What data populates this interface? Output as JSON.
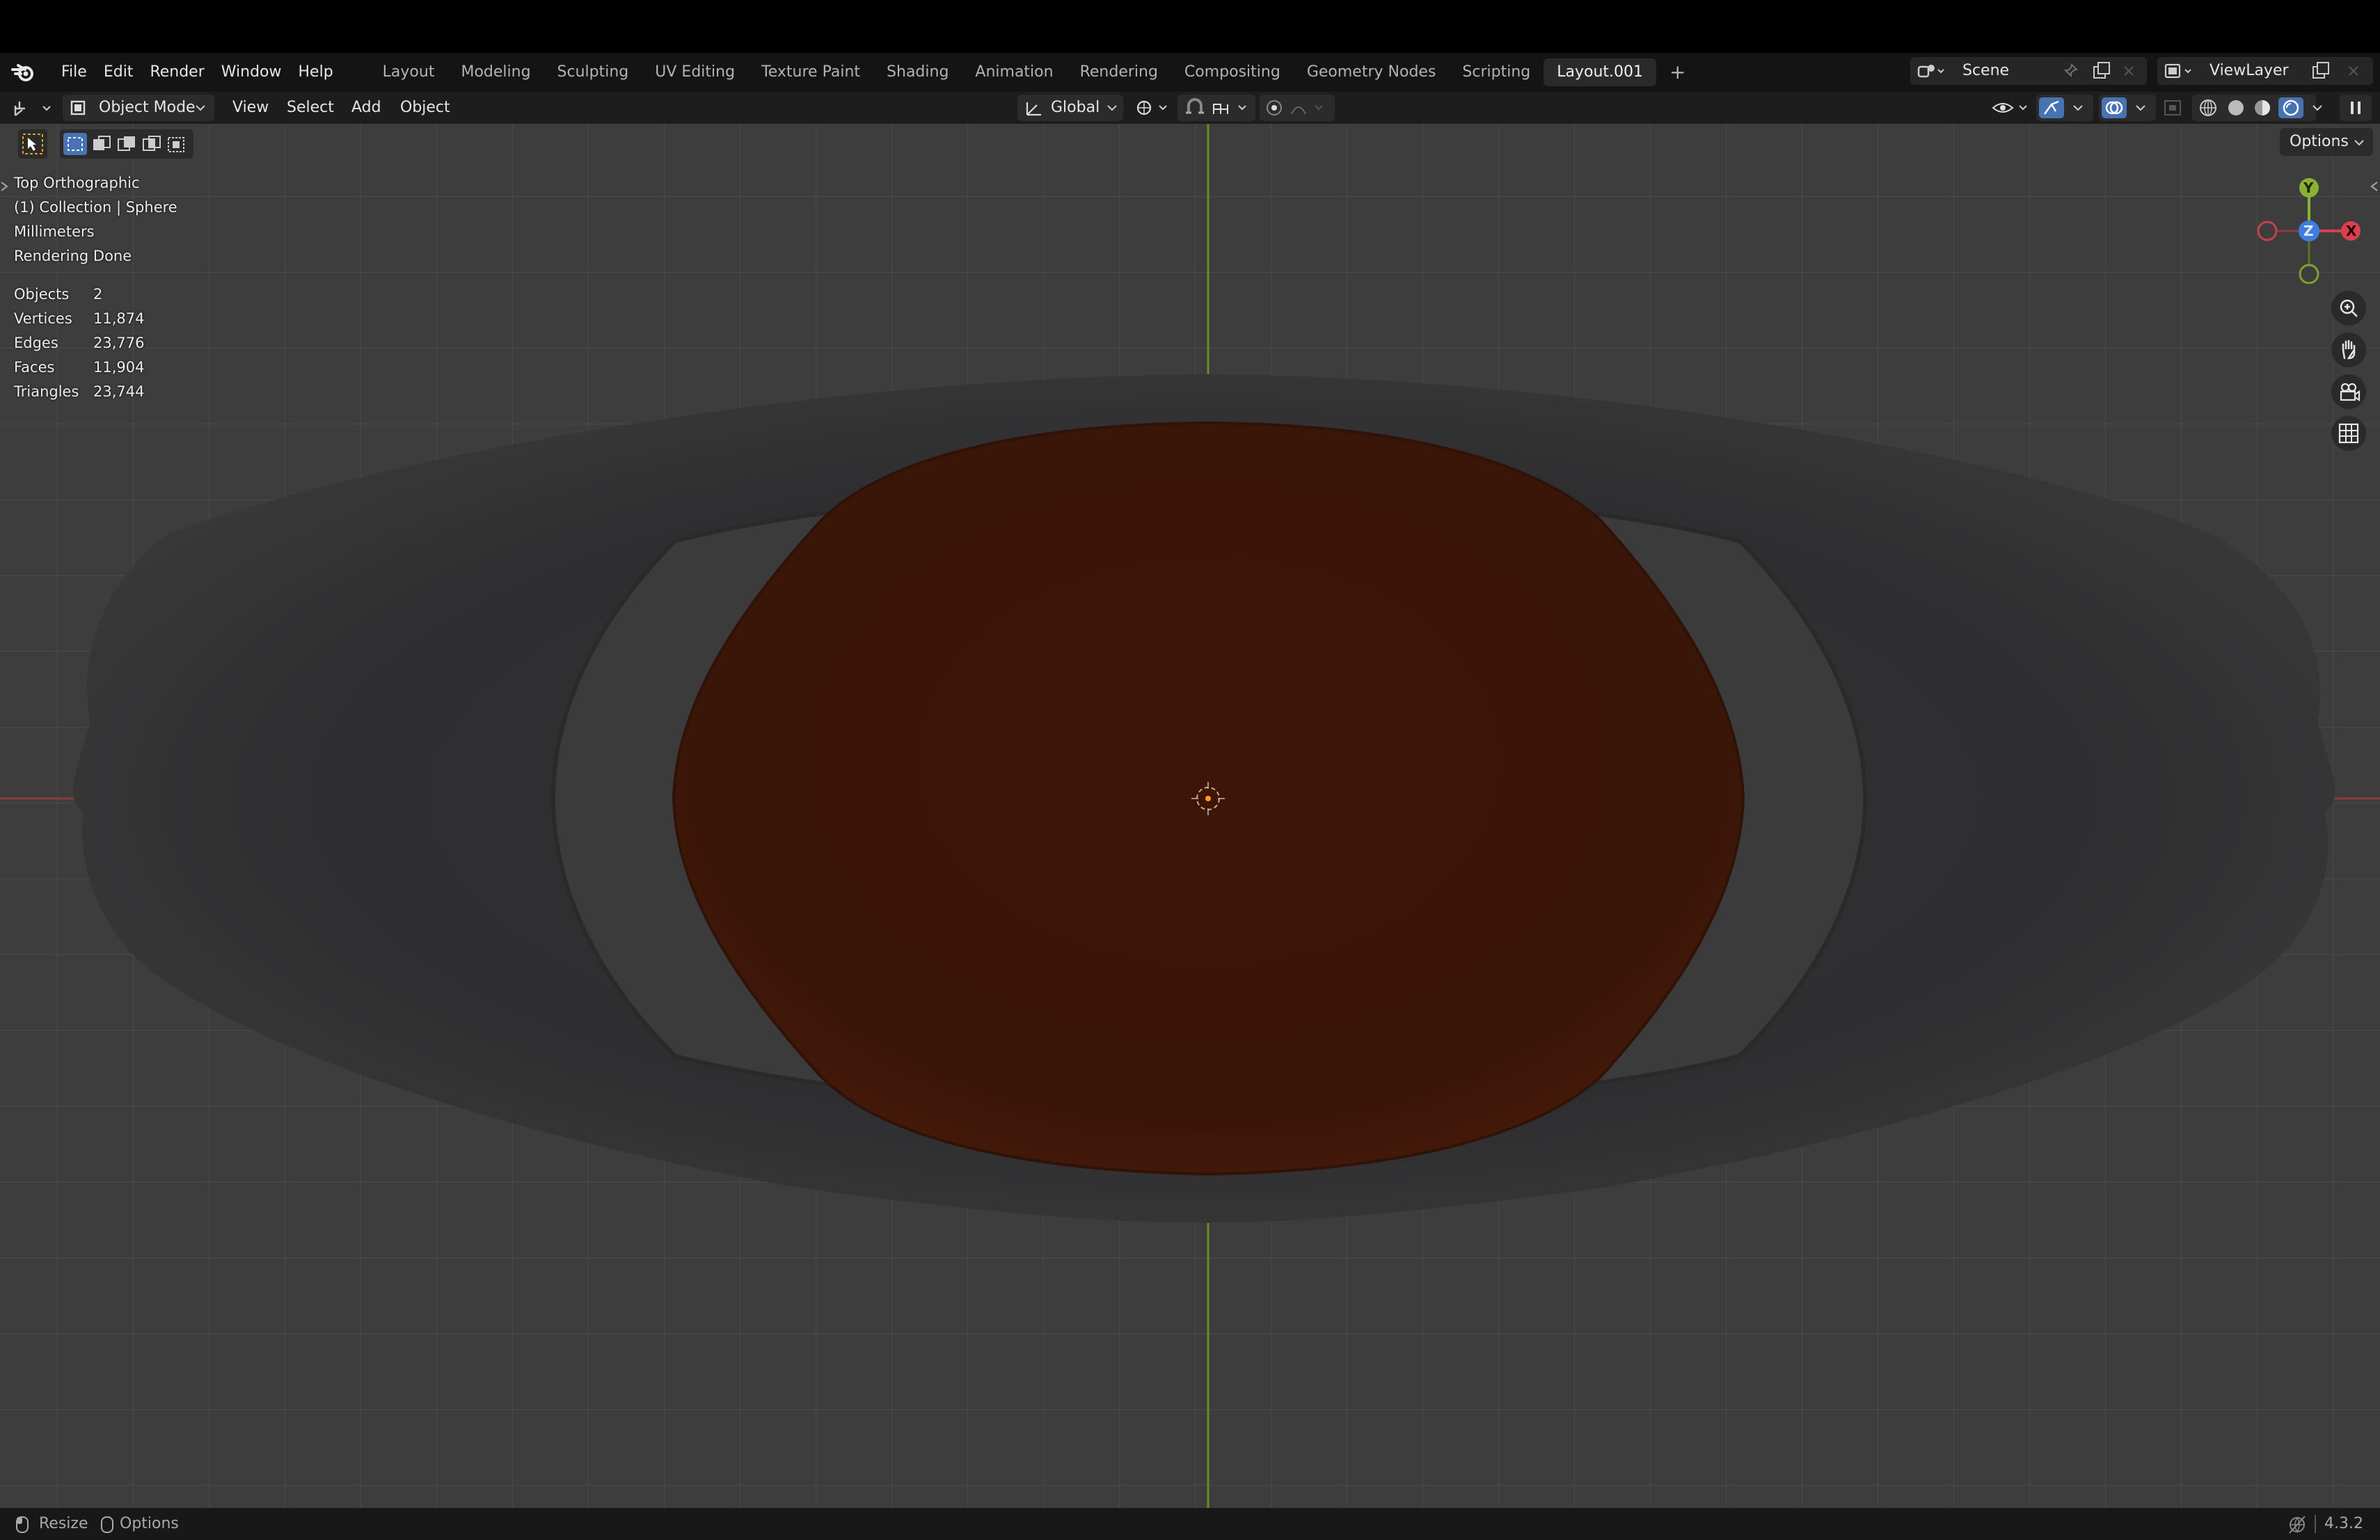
{
  "menubar": {
    "items": [
      "File",
      "Edit",
      "Render",
      "Window",
      "Help"
    ],
    "workspaces": [
      "Layout",
      "Modeling",
      "Sculpting",
      "UV Editing",
      "Texture Paint",
      "Shading",
      "Animation",
      "Rendering",
      "Compositing",
      "Geometry Nodes",
      "Scripting",
      "Layout.001"
    ],
    "active_workspace": "Layout.001",
    "add_tab": "+",
    "scene": "Scene",
    "view_layer": "ViewLayer"
  },
  "header": {
    "mode": "Object Mode",
    "menus": [
      "View",
      "Select",
      "Add",
      "Object"
    ],
    "orientation": "Global",
    "options": "Options"
  },
  "overlay": {
    "view_name": "Top Orthographic",
    "collection": "(1) Collection | Sphere",
    "units": "Millimeters",
    "render_status": "Rendering Done",
    "stats": [
      {
        "label": "Objects",
        "value": "2"
      },
      {
        "label": "Vertices",
        "value": "11,874"
      },
      {
        "label": "Edges",
        "value": "23,776"
      },
      {
        "label": "Faces",
        "value": "11,904"
      },
      {
        "label": "Triangles",
        "value": "23,744"
      }
    ]
  },
  "gizmo": {
    "y": "Y",
    "x": "X",
    "z": "Z"
  },
  "statusbar": {
    "resize": "Resize",
    "options": "Options",
    "version": "4.3.2"
  },
  "colors": {
    "viewport_bg": "#3d3d3d",
    "grid": "#4a4a4a",
    "y_axis": "#6b8a1e",
    "x_axis": "#8a3a3a",
    "object_outer": "#2c2c2e",
    "object_inner": "#3a1408",
    "accent": "#4772b3"
  }
}
